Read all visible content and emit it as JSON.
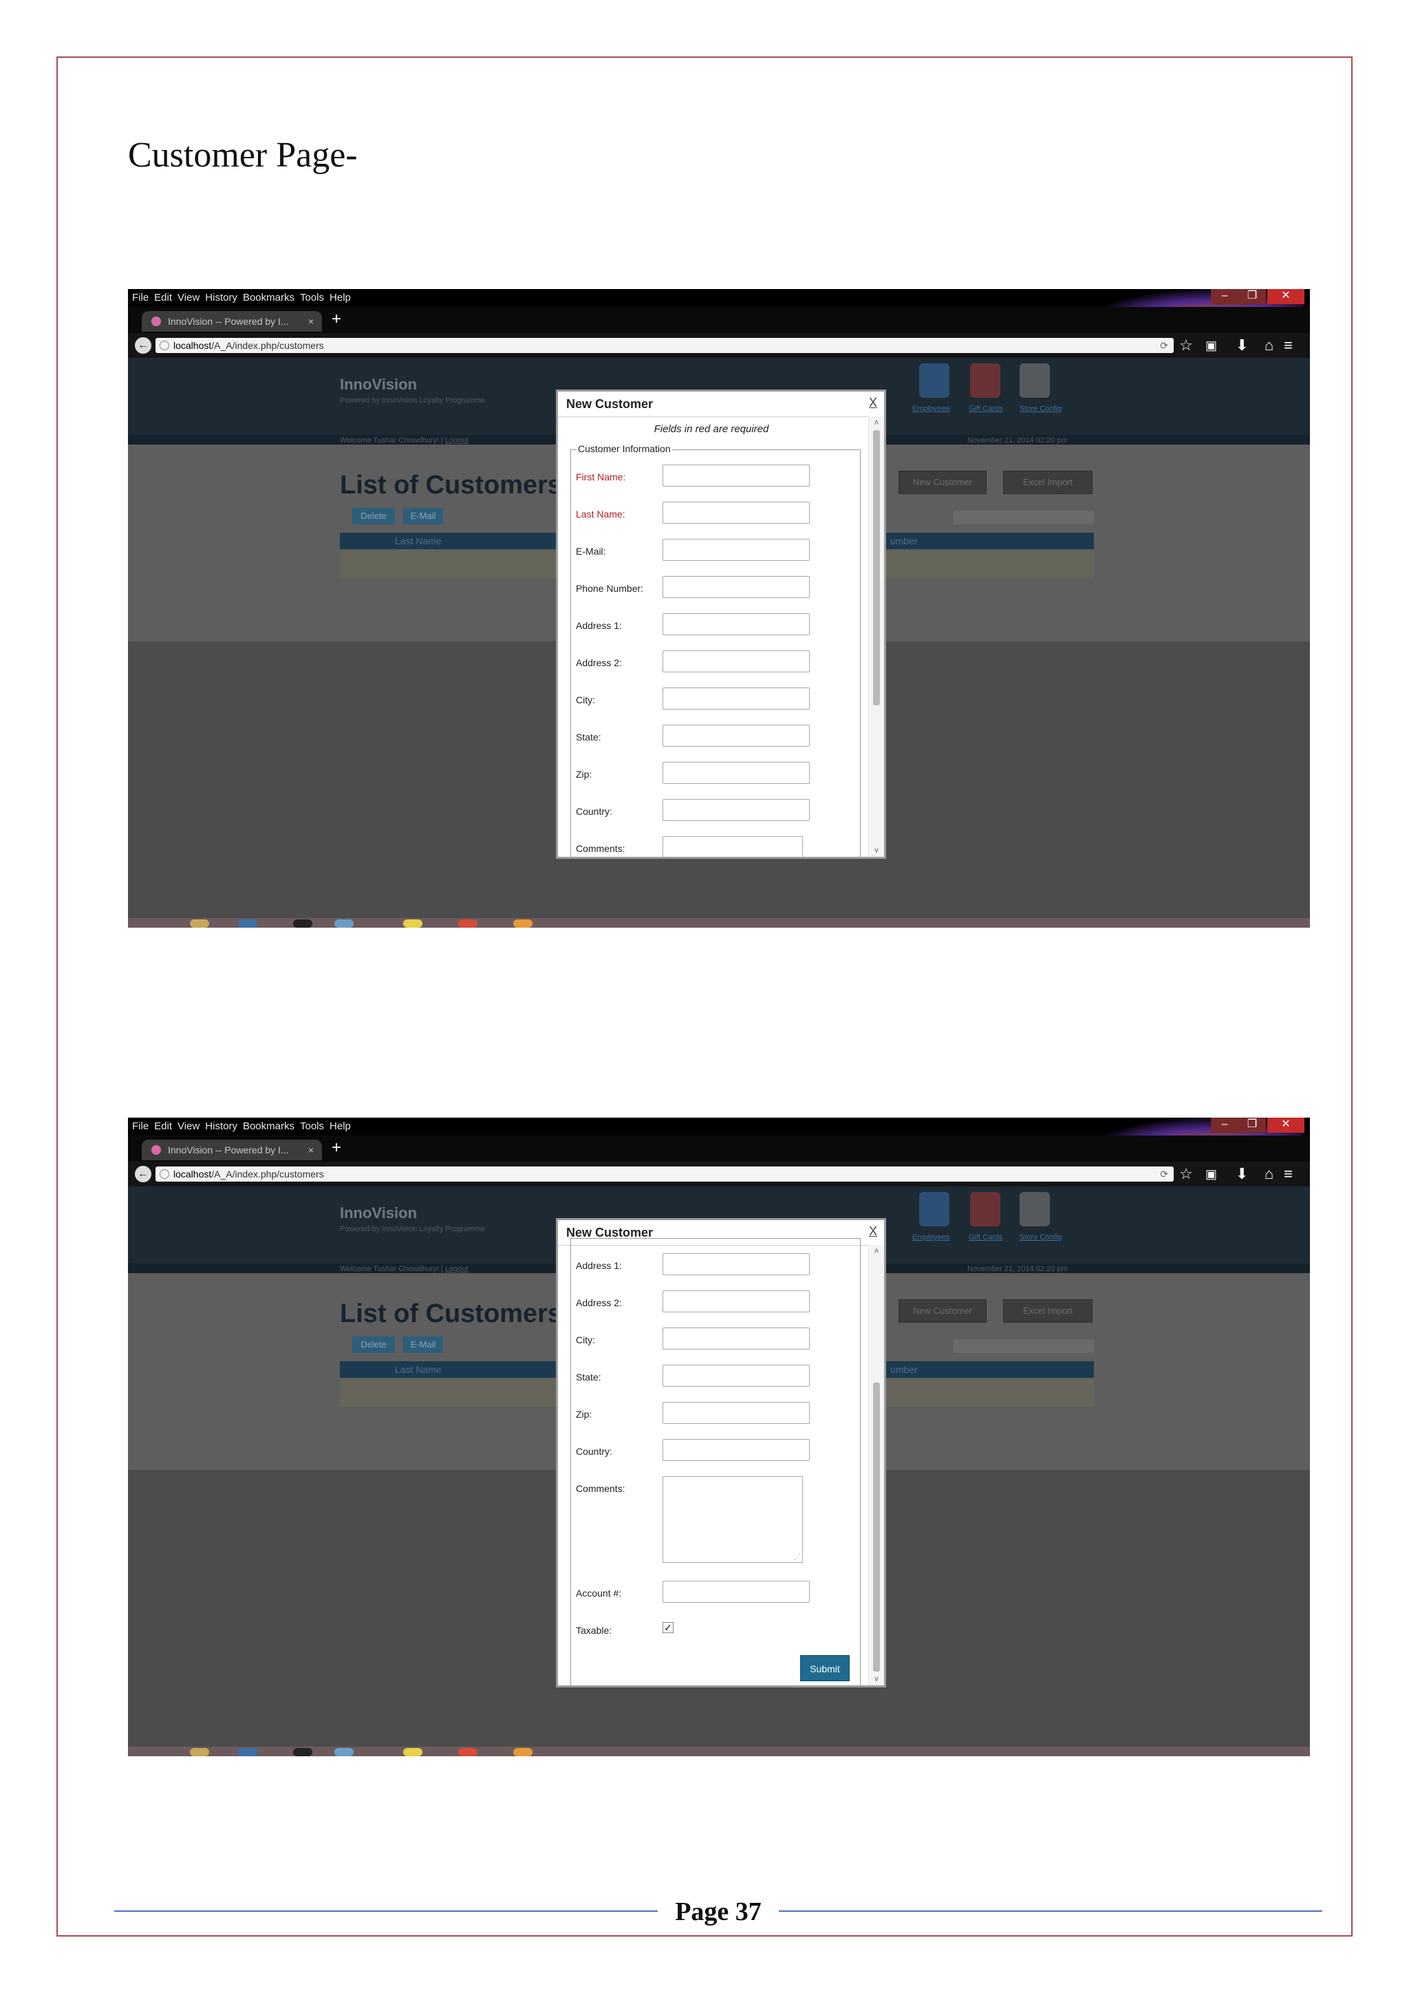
{
  "document": {
    "heading": "Customer Page-",
    "page_label": "Page 37"
  },
  "browser": {
    "menu": [
      "File",
      "Edit",
      "View",
      "History",
      "Bookmarks",
      "Tools",
      "Help"
    ],
    "tab_title": "InnoVision -- Powered by I...",
    "tab_close": "×",
    "new_tab": "+",
    "url_host": "localhost",
    "url_path": "/A_A/index.php/customers"
  },
  "app": {
    "brand": "InnoVision",
    "tagline": "Powered by InnoVision Loyalty Programme",
    "welcome": "Welcome Tushar Chowdhury! |",
    "logout": "Logout",
    "datetime": "November 21, 2014 02:20 pm",
    "nav_labels": [
      "Employees",
      "Gift Cards",
      "Store Config"
    ],
    "list_title": "List of Customers",
    "delete_btn": "Delete",
    "email_btn": "E-Mail",
    "new_customer_btn": "New Customer",
    "excel_import_btn": "Excel Import",
    "col_last_name": "Last Name",
    "col_number": "umber"
  },
  "dialog": {
    "title": "New Customer",
    "close": "X",
    "note": "Fields in red are required",
    "section": "Customer Information",
    "labels": {
      "first_name": "First Name:",
      "last_name": "Last Name:",
      "email": "E-Mail:",
      "phone": "Phone Number:",
      "address1": "Address 1:",
      "address2": "Address 2:",
      "city": "City:",
      "state": "State:",
      "zip": "Zip:",
      "country": "Country:",
      "comments": "Comments:",
      "account": "Account #:",
      "taxable": "Taxable:"
    },
    "taxable_checked": true,
    "submit": "Submit"
  }
}
